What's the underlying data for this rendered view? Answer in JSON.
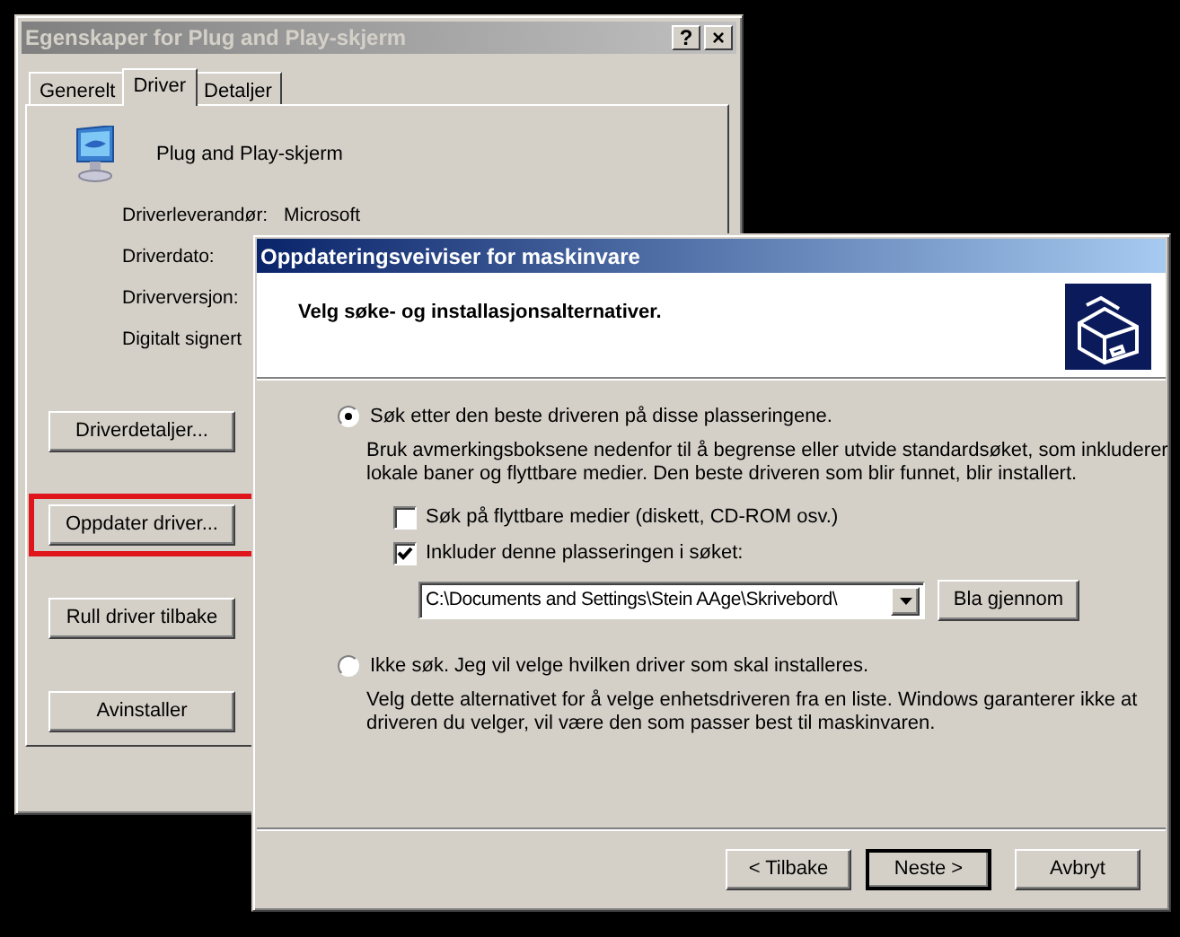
{
  "properties_window": {
    "title": "Egenskaper for Plug and Play-skjerm",
    "title_buttons": [
      "?",
      "×"
    ],
    "tabs": [
      {
        "label": "Generelt",
        "selected": false
      },
      {
        "label": "Driver",
        "selected": true
      },
      {
        "label": "Detaljer",
        "selected": false
      }
    ],
    "device_name": "Plug and Play-skjerm",
    "driver_info": [
      {
        "label": "Driverleverandør:",
        "value": "Microsoft"
      },
      {
        "label": "Driverdato:"
      },
      {
        "label": "Driverversjon:"
      },
      {
        "label": "Digitalt signert"
      }
    ],
    "buttons": [
      {
        "label": "Driverdetaljer...",
        "highlighted": false
      },
      {
        "label": "Oppdater driver...",
        "highlighted": true
      },
      {
        "label": "Rull driver tilbake",
        "highlighted": false
      },
      {
        "label": "Avinstaller",
        "highlighted": false
      }
    ]
  },
  "wizard": {
    "title": "Oppdateringsveiviser for maskinvare",
    "heading": "Velg søke- og installasjonsalternativer.",
    "options": [
      {
        "label": "Søk etter den beste driveren på disse plasseringene.",
        "selected": true,
        "description": "Bruk avmerkingsboksene nedenfor til å begrense eller utvide standardsøket, som inkluderer lokale baner og flyttbare medier. Den beste driveren som blir funnet, blir installert.",
        "checkboxes": [
          {
            "label": "Søk på flyttbare medier (diskett, CD-ROM osv.)",
            "checked": false
          },
          {
            "label": "Inkluder denne plasseringen i søket:",
            "checked": true
          }
        ],
        "path": "C:\\Documents and Settings\\Stein AAge\\Skrivebord\\",
        "browse_button": "Bla gjennom"
      },
      {
        "label": "Ikke søk. Jeg vil velge hvilken driver som skal installeres.",
        "selected": false,
        "description": "Velg dette alternativet for å velge enhetsdriveren fra en liste. Windows garanterer ikke at driveren du velger, vil være den som passer best til maskinvaren."
      }
    ],
    "nav_buttons": [
      {
        "label": "< Tilbake",
        "default": false
      },
      {
        "label": "Neste >",
        "default": true
      },
      {
        "label": "Avbryt",
        "default": false
      }
    ]
  }
}
